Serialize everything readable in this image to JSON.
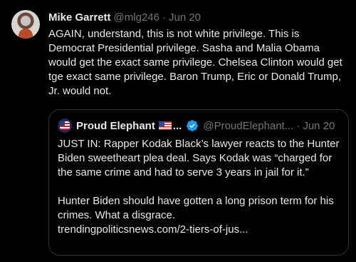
{
  "tweet": {
    "author_name": "Mike Garrett",
    "handle": "@mlg246",
    "separator": "·",
    "date": "Jun 20",
    "text": "AGAIN, understand, this is not white privilege. This is Democrat Presidential privilege. Sasha and Malia Obama would get the exact same privilege. Chelsea Clinton would get tge exact same privilege. Baron Trump, Eric or Donald Trump, Jr. would not."
  },
  "quoted": {
    "author_name": "Proud Elephant",
    "name_ellipsis": "...",
    "flag_icon": "us-flag-icon",
    "verified_icon": "verified-badge-icon",
    "verified_color": "#1d9bf0",
    "handle": "@ProudElephant...",
    "separator": "·",
    "date": "Jun 20",
    "text": "JUST IN: Rapper Kodak Black’s lawyer reacts to the Hunter Biden sweetheart plea deal. Says Kodak was “charged for the same crime and had to serve 3 years in jail for it.”\n\nHunter Biden should have gotten a long prison term for his crimes. What a disgrace.\ntrendingpoliticsnews.com/2-tiers-of-jus..."
  },
  "colors": {
    "background": "#000000",
    "text_primary": "#e7e9ea",
    "text_secondary": "#71767b",
    "border": "#2f3336"
  }
}
